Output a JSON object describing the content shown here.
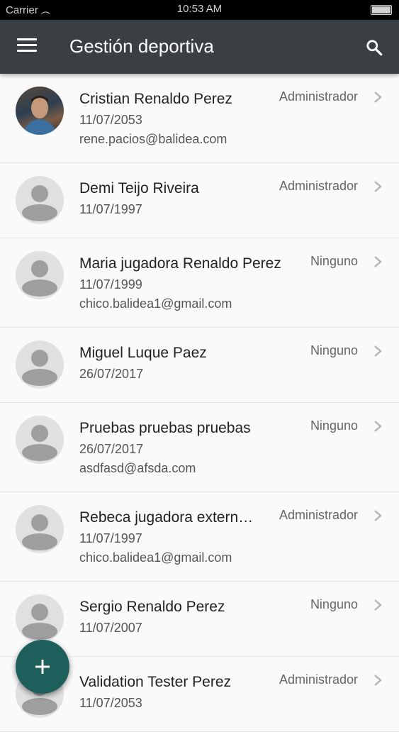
{
  "status_bar": {
    "carrier": "Carrier",
    "time": "10:53 AM"
  },
  "app_bar": {
    "title": "Gestión deportiva"
  },
  "users": [
    {
      "name": "Cristian Renaldo Perez",
      "date": "11/07/2053",
      "email": "rene.pacios@balidea.com",
      "role": "Administrador"
    },
    {
      "name": "Demi Teijo Riveira",
      "date": "11/07/1997",
      "email": "",
      "role": "Administrador"
    },
    {
      "name": "Maria jugadora Renaldo Perez",
      "date": "11/07/1999",
      "email": "chico.balidea1@gmail.com",
      "role": "Ninguno"
    },
    {
      "name": "Miguel Luque Paez",
      "date": "26/07/2017",
      "email": "",
      "role": "Ninguno"
    },
    {
      "name": "Pruebas pruebas pruebas",
      "date": "26/07/2017",
      "email": "asdfasd@afsda.com",
      "role": "Ninguno"
    },
    {
      "name": "Rebeca jugadora extern…",
      "date": "11/07/1997",
      "email": "chico.balidea1@gmail.com",
      "role": "Administrador"
    },
    {
      "name": "Sergio Renaldo Perez",
      "date": "11/07/2007",
      "email": "",
      "role": "Ninguno"
    },
    {
      "name": "Validation Tester Perez",
      "date": "11/07/2053",
      "email": "",
      "role": "Administrador"
    }
  ],
  "icons": {
    "menu": "hamburger-menu-icon",
    "search": "search-icon",
    "add": "plus-icon",
    "row": "chevron-right-icon"
  },
  "colors": {
    "app_bar": "#3a3f44",
    "fab": "#1f5f5b",
    "background": "#fafafa"
  }
}
